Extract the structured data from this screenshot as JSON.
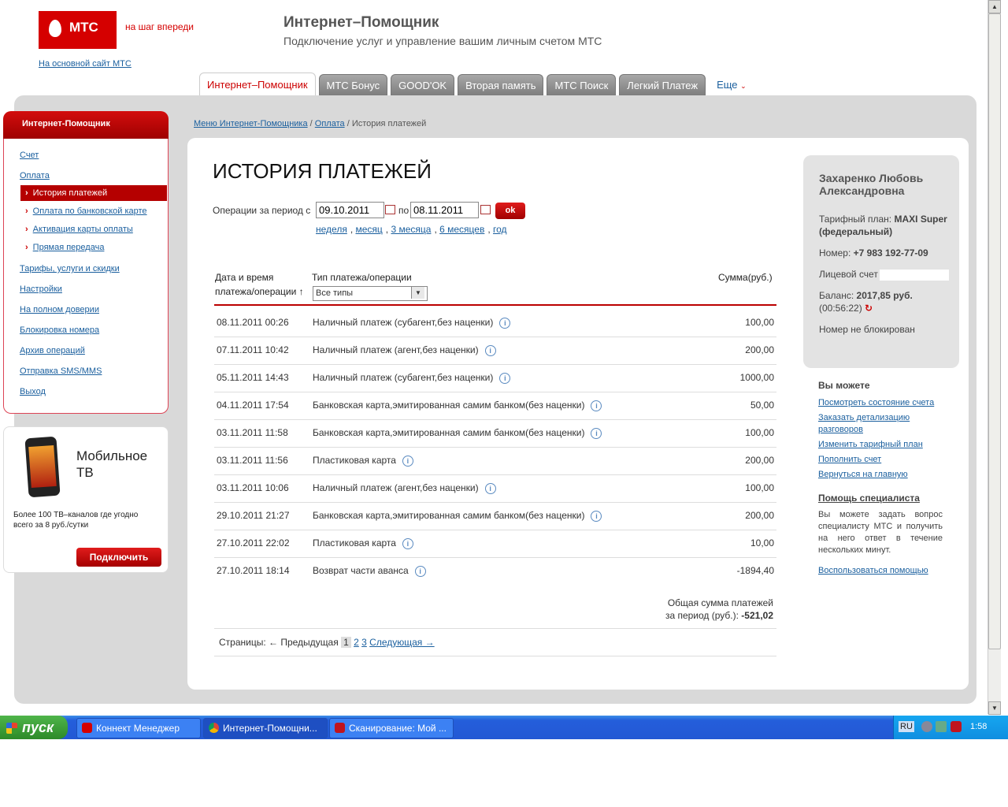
{
  "header": {
    "logo_text": "МТС",
    "slogan": "на шаг впереди",
    "main_site_link": "На основной сайт МТС",
    "title": "Интернет–Помощник",
    "subtitle": "Подключение услуг и управление вашим личным счетом МТС"
  },
  "tabs": [
    {
      "label": "Интернет–Помощник"
    },
    {
      "label": "МТС Бонус"
    },
    {
      "label": "GOOD'OK"
    },
    {
      "label": "Вторая память"
    },
    {
      "label": "МТС Поиск"
    },
    {
      "label": "Легкий Платеж"
    }
  ],
  "tab_more": "Еще",
  "sidebar": {
    "header": "Интернет-Помощник",
    "items": [
      {
        "label": "Счет"
      },
      {
        "label": "Оплата"
      },
      {
        "label": "Тарифы, услуги и скидки"
      },
      {
        "label": "Настройки"
      },
      {
        "label": "На полном доверии"
      },
      {
        "label": "Блокировка номера"
      },
      {
        "label": "Архив операций"
      },
      {
        "label": "Отправка SMS/MMS"
      },
      {
        "label": "Выход"
      }
    ],
    "subitems": [
      {
        "label": "История платежей"
      },
      {
        "label": "Оплата по банковской карте"
      },
      {
        "label": "Активация карты оплаты"
      },
      {
        "label": "Прямая передача"
      }
    ]
  },
  "promo": {
    "title_line1": "Мобильное",
    "title_line2": "ТВ",
    "text": "Более 100 ТВ–каналов где угодно всего за 8 руб./сутки",
    "button": "Подключить"
  },
  "breadcrumb": {
    "item1": "Меню Интернет-Помощника",
    "item2": "Оплата",
    "current": "История платежей",
    "sep": "/"
  },
  "page_title": "ИСТОРИЯ ПЛАТЕЖЕЙ",
  "period": {
    "label": "Операции за период с",
    "from": "09.10.2011",
    "to_label": "по",
    "to": "08.11.2011",
    "ok": "ok",
    "quick": [
      "неделя",
      "месяц",
      "3 месяца",
      "6 месяцев",
      "год"
    ]
  },
  "table": {
    "col1_line1": "Дата и время",
    "col1_line2": "платежа/операции ↑",
    "col2": "Тип платежа/операции",
    "col3": "Сумма(руб.)",
    "filter": "Все типы",
    "rows": [
      {
        "date": "08.11.2011 00:26",
        "type": "Наличный платеж (субагент,без наценки)",
        "sum": "100,00"
      },
      {
        "date": "07.11.2011 10:42",
        "type": "Наличный платеж (агент,без наценки)",
        "sum": "200,00"
      },
      {
        "date": "05.11.2011 14:43",
        "type": "Наличный платеж (субагент,без наценки)",
        "sum": "1000,00"
      },
      {
        "date": "04.11.2011 17:54",
        "type": "Банковская карта,эмитированная самим банком(без наценки)",
        "sum": "50,00"
      },
      {
        "date": "03.11.2011 11:58",
        "type": "Банковская карта,эмитированная самим банком(без наценки)",
        "sum": "100,00"
      },
      {
        "date": "03.11.2011 11:56",
        "type": "Пластиковая карта",
        "sum": "200,00"
      },
      {
        "date": "03.11.2011 10:06",
        "type": "Наличный платеж (агент,без наценки)",
        "sum": "100,00"
      },
      {
        "date": "29.10.2011 21:27",
        "type": "Банковская карта,эмитированная самим банком(без наценки)",
        "sum": "200,00"
      },
      {
        "date": "27.10.2011 22:02",
        "type": "Пластиковая карта",
        "sum": "10,00"
      },
      {
        "date": "27.10.2011 18:14",
        "type": "Возврат части аванса",
        "sum": "-1894,40"
      }
    ]
  },
  "total": {
    "line1": "Общая сумма платежей",
    "line2_label": "за период (руб.):",
    "value": "-521,02"
  },
  "pagination": {
    "label": "Страницы:",
    "prev": "← Предыдущая",
    "current": "1",
    "p2": "2",
    "p3": "3",
    "next": "Следующая →"
  },
  "user": {
    "name": "Захаренко Любовь Александровна",
    "tariff_label": "Тарифный план:",
    "tariff": "MAXI Super (федеральный)",
    "number_label": "Номер:",
    "number": "+7 983 192-77-09",
    "account_label": "Лицевой счет",
    "balance_label": "Баланс:",
    "balance": "2017,85 руб.",
    "balance_time": "(00:56:22)",
    "status": "Номер не блокирован"
  },
  "you_can": {
    "title": "Вы можете",
    "links": [
      "Посмотреть состояние счета",
      "Заказать детализацию разговоров",
      "Изменить тарифный план",
      "Пополнить счет",
      "Вернуться на главную"
    ]
  },
  "help": {
    "title": "Помощь специалиста",
    "text": "Вы можете задать вопрос специалисту МТС и получить на него ответ в течение нескольких минут.",
    "link": "Воспользоваться помощью"
  },
  "taskbar": {
    "start": "пуск",
    "tasks": [
      "Коннект Менеджер",
      "Интернет-Помощни...",
      "Сканирование: Мой ..."
    ],
    "lang": "RU",
    "clock": "1:58"
  },
  "colors": {
    "brand": "#d50000",
    "link": "#1a5f9e",
    "taskbar": "#245edb"
  }
}
